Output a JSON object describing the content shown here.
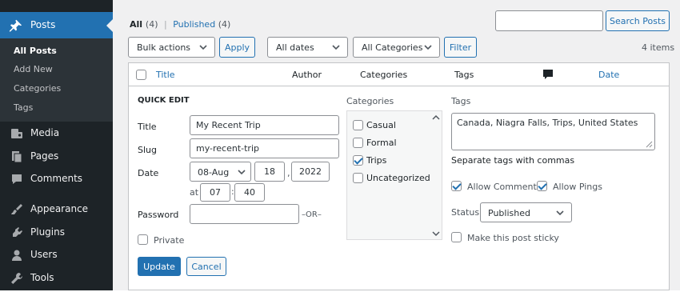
{
  "sidebar": {
    "posts_label": "Posts",
    "submenu": [
      "All Posts",
      "Add New",
      "Categories",
      "Tags"
    ],
    "menu": [
      {
        "label": "Media",
        "icon": "media-icon"
      },
      {
        "label": "Pages",
        "icon": "pages-icon"
      },
      {
        "label": "Comments",
        "icon": "comments-icon"
      },
      {
        "label": "Appearance",
        "icon": "appearance-icon"
      },
      {
        "label": "Plugins",
        "icon": "plugins-icon"
      },
      {
        "label": "Users",
        "icon": "users-icon"
      },
      {
        "label": "Tools",
        "icon": "tools-icon"
      }
    ]
  },
  "filters": {
    "all_label": "All",
    "all_count": "(4)",
    "separator": "|",
    "published_label": "Published",
    "published_count": "(4)",
    "bulk_actions": "Bulk actions",
    "apply": "Apply",
    "dates": "All dates",
    "categories": "All Categories",
    "filter": "Filter",
    "items_count": "4 items",
    "search_value": "",
    "search_button": "Search Posts"
  },
  "table": {
    "col_title": "Title",
    "col_author": "Author",
    "col_categories": "Categories",
    "col_tags": "Tags",
    "col_date": "Date"
  },
  "quick_edit": {
    "heading": "QUICK EDIT",
    "title_label": "Title",
    "title_value": "My Recent Trip",
    "slug_label": "Slug",
    "slug_value": "my-recent-trip",
    "date_label": "Date",
    "month": "08-Aug",
    "day": "18",
    "comma": ",",
    "year": "2022",
    "at_label": "at",
    "hour": "07",
    "colon": ":",
    "minute": "40",
    "password_label": "Password",
    "password_value": "",
    "or_label": "–OR–",
    "private_label": "Private",
    "categories_heading": "Categories",
    "categories": [
      {
        "label": "Casual",
        "checked": false
      },
      {
        "label": "Formal",
        "checked": false
      },
      {
        "label": "Trips",
        "checked": true
      },
      {
        "label": "Uncategorized",
        "checked": false
      }
    ],
    "tags_heading": "Tags",
    "tags_value": "Canada, Niagra Falls, Trips, United States",
    "tags_hint": "Separate tags with commas",
    "allow_comments": "Allow Comments",
    "allow_pings": "Allow Pings",
    "status_label": "Status",
    "status_value": "Published",
    "sticky_label": "Make this post sticky",
    "update": "Update",
    "cancel": "Cancel"
  },
  "colors": {
    "sidebar_bg": "#1d2327",
    "sidebar_active": "#2271b1",
    "link": "#2271b1",
    "primary_button": "#2271b1"
  }
}
